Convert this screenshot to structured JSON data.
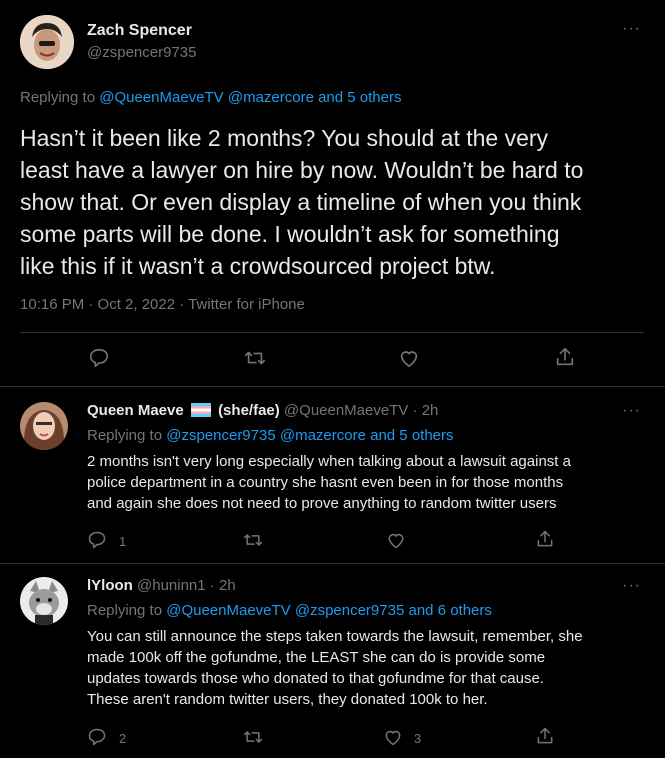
{
  "main_tweet": {
    "author_name": "Zach Spencer",
    "author_handle": "@zspencer9735",
    "replying_prefix": "Replying to",
    "replying_to": "@QueenMaeveTV @mazercore",
    "replying_others": "and 5 others",
    "text_lines": [
      "Hasn’t it been like 2 months? You should at the very",
      "least have a lawyer on hire by now. Wouldn’t be hard to",
      "show that. Or even display a timeline of when you think",
      "some parts will be done. I wouldn’t ask for something",
      "like this if it wasn’t a crowdsourced project btw."
    ],
    "meta": "10:16 PM · Oct 2, 2022 · Twitter for iPhone",
    "more": "···"
  },
  "replies": [
    {
      "author_name": "Queen Maeve",
      "pronouns": "(she/fae)",
      "author_handle": "@QueenMaeveTV",
      "time": "· 2h",
      "replying_prefix": "Replying to",
      "replying_to": "@zspencer9735 @mazercore",
      "replying_others": "and 5 others",
      "text_lines": [
        "2 months isn't very long especially when talking about a lawsuit against a",
        "police department in a country she hasnt even been in for those months",
        "and again she does not need to prove anything to random twitter users"
      ],
      "reply_count": "1",
      "retweet_count": "",
      "like_count": "",
      "more": "···"
    },
    {
      "author_name": "lYloon",
      "author_handle": "@huninn1",
      "time": "· 2h",
      "replying_prefix": "Replying to",
      "replying_to": "@QueenMaeveTV @zspencer9735",
      "replying_others": "and 6 others",
      "text_lines": [
        "You can still announce the steps taken towards the lawsuit, remember, she",
        "made 100k off the gofundme, the LEAST she can do is provide some",
        "updates towards those who donated to that gofundme for that cause.",
        "These aren't random twitter users, they donated 100k to her."
      ],
      "reply_count": "2",
      "retweet_count": "",
      "like_count": "3",
      "more": "···"
    }
  ],
  "icons": [
    "reply-icon",
    "retweet-icon",
    "like-icon",
    "share-icon",
    "trans-flag-icon"
  ],
  "colors": {
    "background": "#000000",
    "text": "#e7e9ea",
    "muted": "#71767b",
    "link": "#1d9bf0",
    "divider": "#2f3336"
  }
}
